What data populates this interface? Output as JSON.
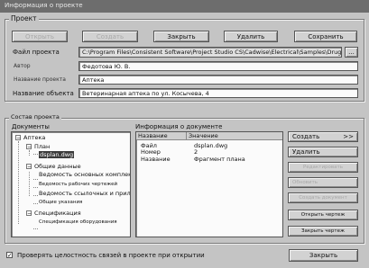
{
  "window": {
    "title": "Информация о проекте"
  },
  "project": {
    "legend": "Проект",
    "buttons": {
      "open": "Открыть",
      "create": "Создать",
      "close": "Закрыть",
      "delete": "Удалить",
      "save": "Сохранить"
    },
    "file_label": "Файл проекта",
    "file_value": "C:\\Program Files\\Consistent Software\\Project Studio CS\\Cadwise\\Electrical\\Samples\\Drug",
    "browse_label": "...",
    "author_label": "Автор",
    "author_value": "Федотова Ю. В.",
    "name_label": "Название проекта",
    "name_value": "Аптека",
    "object_label": "Название объекта",
    "object_value": "Ветеринарная аптека по ул. Косычева, 4"
  },
  "composition": {
    "legend": "Состав проекта",
    "documents_label": "Документы",
    "tree": [
      {
        "label": "Аптека",
        "sign": "−"
      },
      {
        "label": "План",
        "sign": "−"
      },
      {
        "label": "dsplan.dwg",
        "selected": true
      },
      {
        "label": "Общие данные",
        "sign": "−"
      },
      {
        "label": "Ведомость основных комплектов"
      },
      {
        "label": "Ведомость рабочих чертежей"
      },
      {
        "label": "Ведомость ссылочных и прилагаемых"
      },
      {
        "label": "Общие указания"
      },
      {
        "label": "Спецификация",
        "sign": "−"
      },
      {
        "label": "Спецификация оборудования"
      }
    ],
    "info_label": "Информация о документе",
    "columns": {
      "name": "Название",
      "value": "Значение"
    },
    "rows": [
      {
        "name": "Файл",
        "value": "dsplan.dwg"
      },
      {
        "name": "Номер",
        "value": "2"
      },
      {
        "name": "Название",
        "value": "Фрагмент плана"
      }
    ],
    "buttons": {
      "create": "Создать",
      "create_arrow": ">>",
      "delete": "Удалить",
      "b3": "Редактировать",
      "b4": "Обновить",
      "b5": "Создать документ",
      "open_drawing": "Открыть чертеж",
      "close_drawing": "Закрыть чертеж"
    }
  },
  "footer": {
    "check_label": "Проверять целостность связей в проекте при открытии",
    "checked": true,
    "close": "Закрыть"
  }
}
